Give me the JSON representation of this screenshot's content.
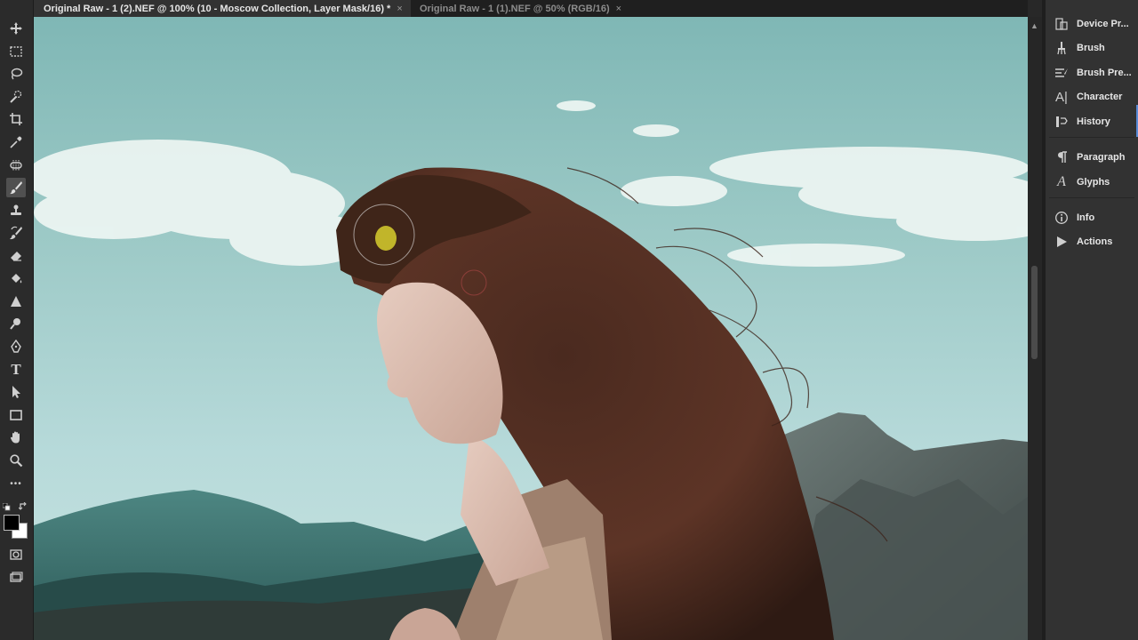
{
  "tabs": [
    {
      "label": "Original Raw - 1 (2).NEF @ 100% (10 - Moscow Collection, Layer Mask/16) *",
      "close": "×"
    },
    {
      "label": "Original Raw - 1 (1).NEF @ 50% (RGB/16)",
      "close": "×"
    }
  ],
  "toolbar": {
    "tools": [
      "move-tool",
      "marquee-tool",
      "lasso-tool",
      "quick-selection-tool",
      "crop-tool",
      "eyedropper-tool",
      "spot-healing-tool",
      "brush-tool",
      "clone-stamp-tool",
      "history-brush-tool",
      "eraser-tool",
      "paint-bucket-tool",
      "sharpen-tool",
      "dodge-tool",
      "pen-tool",
      "type-tool",
      "path-selection-tool",
      "rectangle-tool",
      "hand-tool",
      "zoom-tool",
      "more-tools"
    ],
    "selected_tool": "brush-tool",
    "type_glyph": "T",
    "more_glyph": "•••",
    "foreground_color": "#000000",
    "background_color": "#ffffff"
  },
  "panels": {
    "group1": [
      {
        "label": "Device Pr...",
        "icon": "device-preview-icon"
      },
      {
        "label": "Brush",
        "icon": "brush-panel-icon"
      },
      {
        "label": "Brush Pre...",
        "icon": "brush-presets-icon"
      },
      {
        "label": "Character",
        "icon": "character-icon"
      },
      {
        "label": "History",
        "icon": "history-icon"
      }
    ],
    "group2": [
      {
        "label": "Paragraph",
        "icon": "paragraph-icon"
      },
      {
        "label": "Glyphs",
        "icon": "glyphs-icon"
      }
    ],
    "group3": [
      {
        "label": "Info",
        "icon": "info-icon"
      },
      {
        "label": "Actions",
        "icon": "actions-icon"
      }
    ],
    "glyph_char": "A",
    "character_char": "A|"
  },
  "scroll": {
    "up_arrow": "▲"
  },
  "colors": {
    "app_bg": "#282828",
    "panel_bg": "#323232",
    "active_tab": "#323232",
    "brush_cursor": "#e6d23a"
  }
}
